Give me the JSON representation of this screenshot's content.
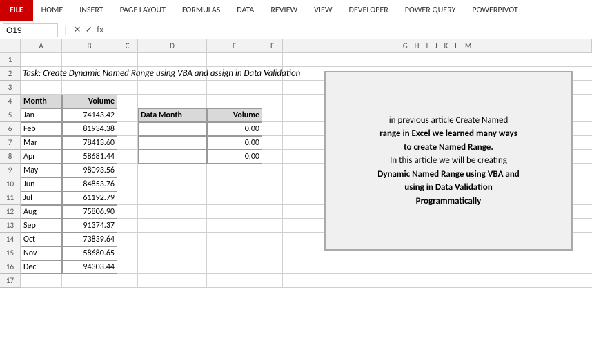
{
  "ribbon": {
    "file_label": "FILE",
    "tabs": [
      "HOME",
      "INSERT",
      "PAGE LAYOUT",
      "FORMULAS",
      "DATA",
      "REVIEW",
      "VIEW",
      "DEVELOPER",
      "POWER QUERY",
      "POWERPIVOT"
    ]
  },
  "formula_bar": {
    "name_box_value": "O19",
    "formula_value": "fx"
  },
  "task_text": "Task:  Create Dynamic Named Range using VBA and assign in Data Validation",
  "main_table": {
    "headers": [
      "Month",
      "Volume"
    ],
    "rows": [
      [
        "Jan",
        "74143.42"
      ],
      [
        "Feb",
        "81934.38"
      ],
      [
        "Mar",
        "78413.60"
      ],
      [
        "Apr",
        "58681.44"
      ],
      [
        "May",
        "98093.56"
      ],
      [
        "Jun",
        "84853.76"
      ],
      [
        "Jul",
        "61192.79"
      ],
      [
        "Aug",
        "75806.90"
      ],
      [
        "Sep",
        "91374.37"
      ],
      [
        "Oct",
        "73839.64"
      ],
      [
        "Nov",
        "58680.65"
      ],
      [
        "Dec",
        "94303.44"
      ]
    ]
  },
  "data_table": {
    "headers": [
      "Data Month",
      "Volume"
    ],
    "rows": [
      [
        "",
        "0.00"
      ],
      [
        "",
        "0.00"
      ],
      [
        "",
        "0.00"
      ]
    ]
  },
  "info_box": {
    "line1": "in previous article Create Named",
    "line2": "range in Excel we learned many ways",
    "line3": "to create Named Range.",
    "line4": "In this article we will be creating",
    "line5": "Dynamic Named Range using VBA and",
    "line6": "using in Data Validation",
    "line7": "Programmatically"
  },
  "col_labels": [
    "",
    "A",
    "B",
    "C",
    "D",
    "E",
    "F",
    "G",
    "H",
    "I",
    "J",
    "K",
    "L",
    "M"
  ],
  "row_labels": [
    "1",
    "2",
    "3",
    "4",
    "5",
    "6",
    "7",
    "8",
    "9",
    "10",
    "11",
    "12",
    "13",
    "14",
    "15",
    "16",
    "17"
  ]
}
